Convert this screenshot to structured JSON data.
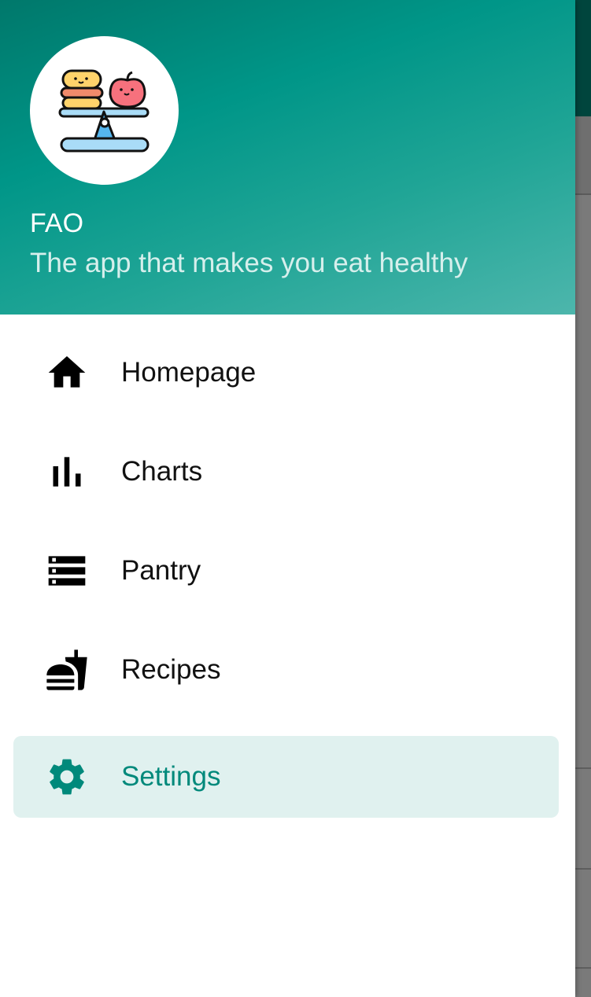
{
  "app": {
    "name": "FAO",
    "tagline": "The app that makes you eat healthy"
  },
  "nav": {
    "items": [
      {
        "label": "Homepage",
        "icon": "home-icon",
        "active": false
      },
      {
        "label": "Charts",
        "icon": "bar-chart-icon",
        "active": false
      },
      {
        "label": "Pantry",
        "icon": "storage-icon",
        "active": false
      },
      {
        "label": "Recipes",
        "icon": "fastfood-icon",
        "active": false
      },
      {
        "label": "Settings",
        "icon": "gear-icon",
        "active": true
      }
    ]
  },
  "colors": {
    "primary": "#009688",
    "active_bg": "#e0f1ef",
    "active_text": "#00897b"
  }
}
